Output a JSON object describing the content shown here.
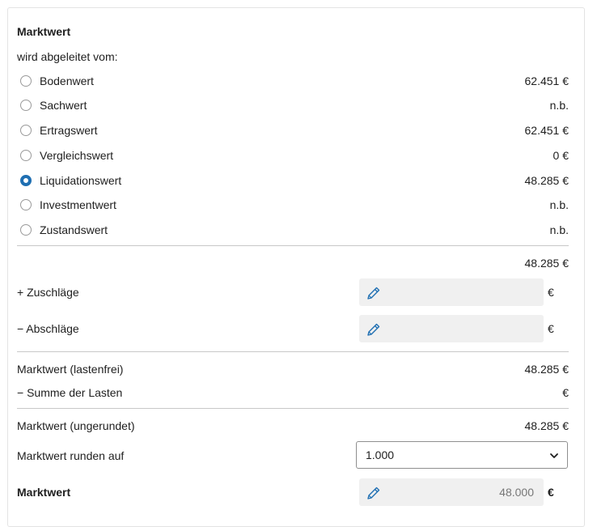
{
  "section": {
    "title": "Marktwert",
    "subtitle": "wird abgeleitet vom:"
  },
  "options": [
    {
      "label": "Bodenwert",
      "value": "62.451 €",
      "selected": false
    },
    {
      "label": "Sachwert",
      "value": "n.b.",
      "selected": false
    },
    {
      "label": "Ertragswert",
      "value": "62.451 €",
      "selected": false
    },
    {
      "label": "Vergleichswert",
      "value": "0 €",
      "selected": false
    },
    {
      "label": "Liquidationswert",
      "value": "48.285 €",
      "selected": true
    },
    {
      "label": "Investmentwert",
      "value": "n.b.",
      "selected": false
    },
    {
      "label": "Zustandswert",
      "value": "n.b.",
      "selected": false
    }
  ],
  "subtotal": "48.285 €",
  "zuschlaege": {
    "label": "+ Zuschläge",
    "value": "",
    "unit": "€"
  },
  "abschlaege": {
    "label": "− Abschläge",
    "value": "",
    "unit": "€"
  },
  "lastenfrei": {
    "label": "Marktwert (lastenfrei)",
    "value": "48.285 €"
  },
  "lasten": {
    "label": "− Summe der Lasten",
    "value": "€"
  },
  "ungerundet": {
    "label": "Marktwert (ungerundet)",
    "value": "48.285 €"
  },
  "runden": {
    "label": "Marktwert runden auf",
    "selected": "1.000"
  },
  "final": {
    "label": "Marktwert",
    "value": "48.000",
    "unit": "€"
  },
  "colors": {
    "accent": "#1f6fb2",
    "input_bg": "#f0f0f0",
    "divider": "#c8c8c8"
  },
  "icons": {
    "edit": "pencil-icon",
    "dropdown": "chevron-down-icon"
  }
}
